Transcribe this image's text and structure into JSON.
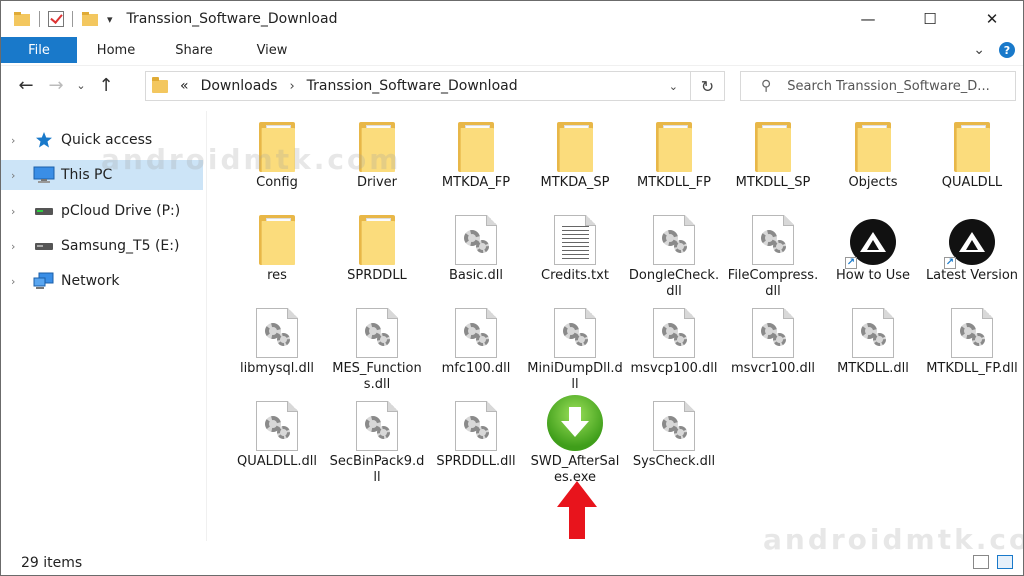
{
  "window": {
    "title": "Transsion_Software_Download",
    "minimize": "—",
    "maximize": "☐",
    "close": "✕"
  },
  "ribbon": {
    "tabs": [
      "File",
      "Home",
      "Share",
      "View"
    ],
    "expand": "⌄",
    "help": "?"
  },
  "address": {
    "overflow": "«",
    "breadcrumbs": [
      "Downloads",
      "Transsion_Software_Download"
    ],
    "separator": "›",
    "refresh": "↻",
    "dropdown": "⌄"
  },
  "search": {
    "placeholder": "Search Transsion_Software_D..."
  },
  "nav_pane": {
    "items": [
      {
        "label": "Quick access",
        "icon": "star-icon"
      },
      {
        "label": "This PC",
        "icon": "computer-icon",
        "selected": true
      },
      {
        "label": "pCloud Drive (P:)",
        "icon": "drive-icon"
      },
      {
        "label": "Samsung_T5 (E:)",
        "icon": "drive-icon"
      },
      {
        "label": "Network",
        "icon": "network-icon"
      }
    ]
  },
  "files": [
    {
      "label": "Config",
      "type": "folder"
    },
    {
      "label": "Driver",
      "type": "folder"
    },
    {
      "label": "MTKDA_FP",
      "type": "folder"
    },
    {
      "label": "MTKDA_SP",
      "type": "folder"
    },
    {
      "label": "MTKDLL_FP",
      "type": "folder"
    },
    {
      "label": "MTKDLL_SP",
      "type": "folder"
    },
    {
      "label": "Objects",
      "type": "folder"
    },
    {
      "label": "QUALDLL",
      "type": "folder"
    },
    {
      "label": "res",
      "type": "folder"
    },
    {
      "label": "SPRDDLL",
      "type": "folder"
    },
    {
      "label": "Basic.dll",
      "type": "dll"
    },
    {
      "label": "Credits.txt",
      "type": "txt"
    },
    {
      "label": "DongleCheck.dll",
      "type": "dll"
    },
    {
      "label": "FileCompress.dll",
      "type": "dll"
    },
    {
      "label": "How to Use",
      "type": "shortcut"
    },
    {
      "label": "Latest Version",
      "type": "shortcut"
    },
    {
      "label": "libmysql.dll",
      "type": "dll"
    },
    {
      "label": "MES_Functions.dll",
      "type": "dll"
    },
    {
      "label": "mfc100.dll",
      "type": "dll"
    },
    {
      "label": "MiniDumpDll.dll",
      "type": "dll"
    },
    {
      "label": "msvcp100.dll",
      "type": "dll"
    },
    {
      "label": "msvcr100.dll",
      "type": "dll"
    },
    {
      "label": "MTKDLL.dll",
      "type": "dll"
    },
    {
      "label": "MTKDLL_FP.dll",
      "type": "dll"
    },
    {
      "label": "QUALDLL.dll",
      "type": "dll"
    },
    {
      "label": "SecBinPack9.dll",
      "type": "dll"
    },
    {
      "label": "SPRDDLL.dll",
      "type": "dll"
    },
    {
      "label": "SWD_AfterSales.exe",
      "type": "exe"
    },
    {
      "label": "SysCheck.dll",
      "type": "dll"
    }
  ],
  "status": {
    "item_count": "29 items"
  },
  "watermark": "androidmtk.com",
  "colors": {
    "accent": "#1979ca",
    "selection": "#cce4f7",
    "annotation_arrow": "#e8141c"
  }
}
